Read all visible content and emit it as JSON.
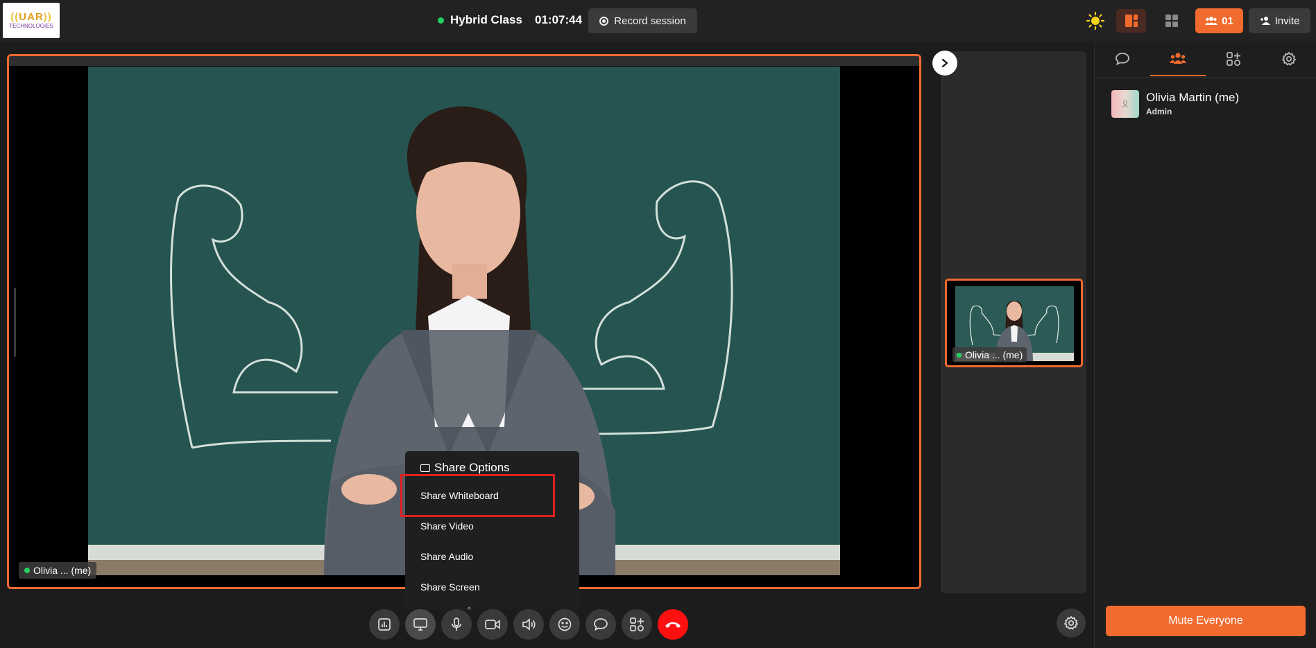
{
  "app": {
    "logo_line1_a": "UAR",
    "logo_line2": "TECHNOLOGIES"
  },
  "header": {
    "session_title": "Hybrid Class",
    "timer": "01:07:44",
    "record_label": "Record session",
    "participant_count": "01",
    "invite_label": "Invite",
    "status_color": "#23d160",
    "accent_color": "#f26b2e"
  },
  "main_video": {
    "name_tag": "Olivia ... (me)"
  },
  "thumbnail": {
    "name_tag": "Olivia ... (me)"
  },
  "share_menu": {
    "title": "Share Options",
    "items": [
      "Share Whiteboard",
      "Share Video",
      "Share Audio",
      "Share Screen"
    ],
    "highlighted": "Share Whiteboard"
  },
  "panel": {
    "tabs": [
      "chat-icon",
      "participants-icon",
      "apps-icon",
      "settings-icon"
    ],
    "active_tab": "participants-icon",
    "participants": [
      {
        "name": "Olivia Martin (me)",
        "role": "Admin"
      }
    ],
    "mute_all_label": "Mute Everyone"
  },
  "controls": [
    "poll-icon",
    "share-screen-icon",
    "microphone-icon",
    "camera-icon",
    "speaker-icon",
    "emoji-icon",
    "chat-bubble-icon",
    "apps-icon",
    "end-call-icon"
  ]
}
